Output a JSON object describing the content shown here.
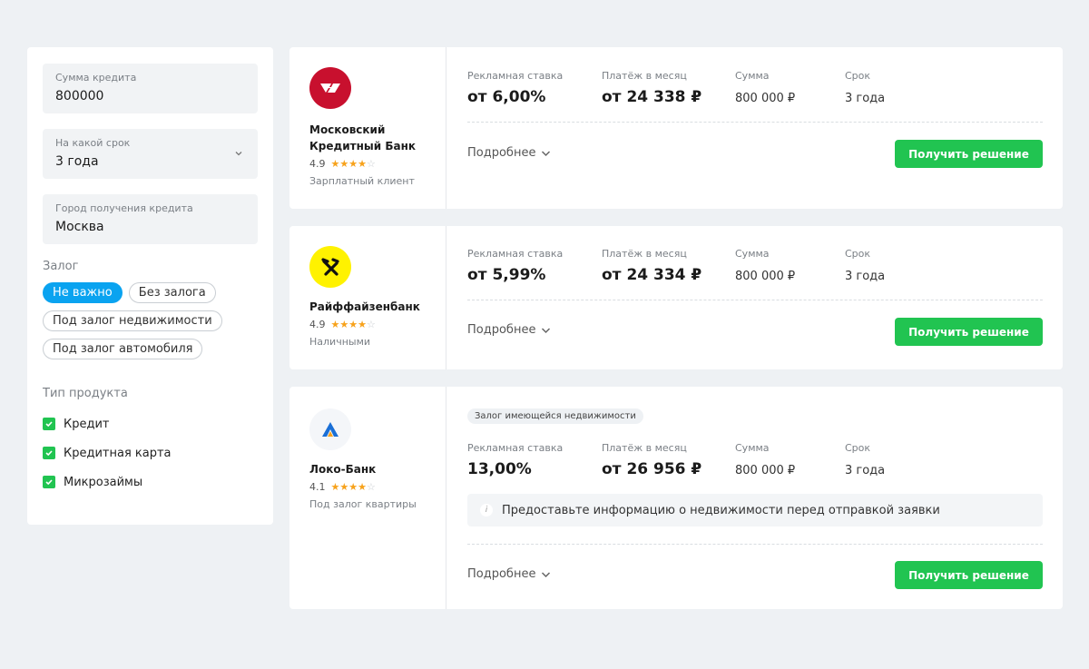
{
  "filters": {
    "amount": {
      "label": "Сумма кредита",
      "value": "800000"
    },
    "term": {
      "label": "На какой срок",
      "value": "3 года"
    },
    "city": {
      "label": "Город получения кредита",
      "value": "Москва"
    },
    "collateral_title": "Залог",
    "collateral_options": [
      "Не важно",
      "Без залога",
      "Под залог недвижимости",
      "Под залог автомобиля"
    ],
    "collateral_selected": "Не важно",
    "product_title": "Тип продукта",
    "products": [
      "Кредит",
      "Кредитная карта",
      "Микрозаймы"
    ]
  },
  "labels": {
    "rate": "Рекламная ставка",
    "payment": "Платёж в месяц",
    "sum": "Сумма",
    "term": "Срок",
    "more": "Подробнее",
    "cta": "Получить решение"
  },
  "offers": [
    {
      "bank": "Московский Кредитный Банк",
      "rating": "4.9",
      "stars": 4,
      "subtitle": "Зарплатный клиент",
      "rate": "от 6,00%",
      "payment": "от 24 338 ₽",
      "sum": "800 000 ₽",
      "term": "3 года",
      "logo_color": "#c8102e"
    },
    {
      "bank": "Райффайзенбанк",
      "rating": "4.9",
      "stars": 4,
      "subtitle": "Наличными",
      "rate": "от 5,99%",
      "payment": "от 24 334 ₽",
      "sum": "800 000 ₽",
      "term": "3 года",
      "logo_color": "#fff200"
    },
    {
      "bank": "Локо-Банк",
      "rating": "4.1",
      "stars": 4,
      "subtitle": "Под залог квартиры",
      "tag": "Залог имеющейся недвижимости",
      "rate": "13,00%",
      "payment": "от 26 956 ₽",
      "sum": "800 000 ₽",
      "term": "3 года",
      "info": "Предоставьте информацию о недвижимости перед отправкой заявки",
      "logo_color": "#f4f6f9"
    }
  ],
  "colors": {
    "accent_green": "#21c451",
    "accent_blue": "#0aa3f0",
    "star": "#f7a21b"
  }
}
